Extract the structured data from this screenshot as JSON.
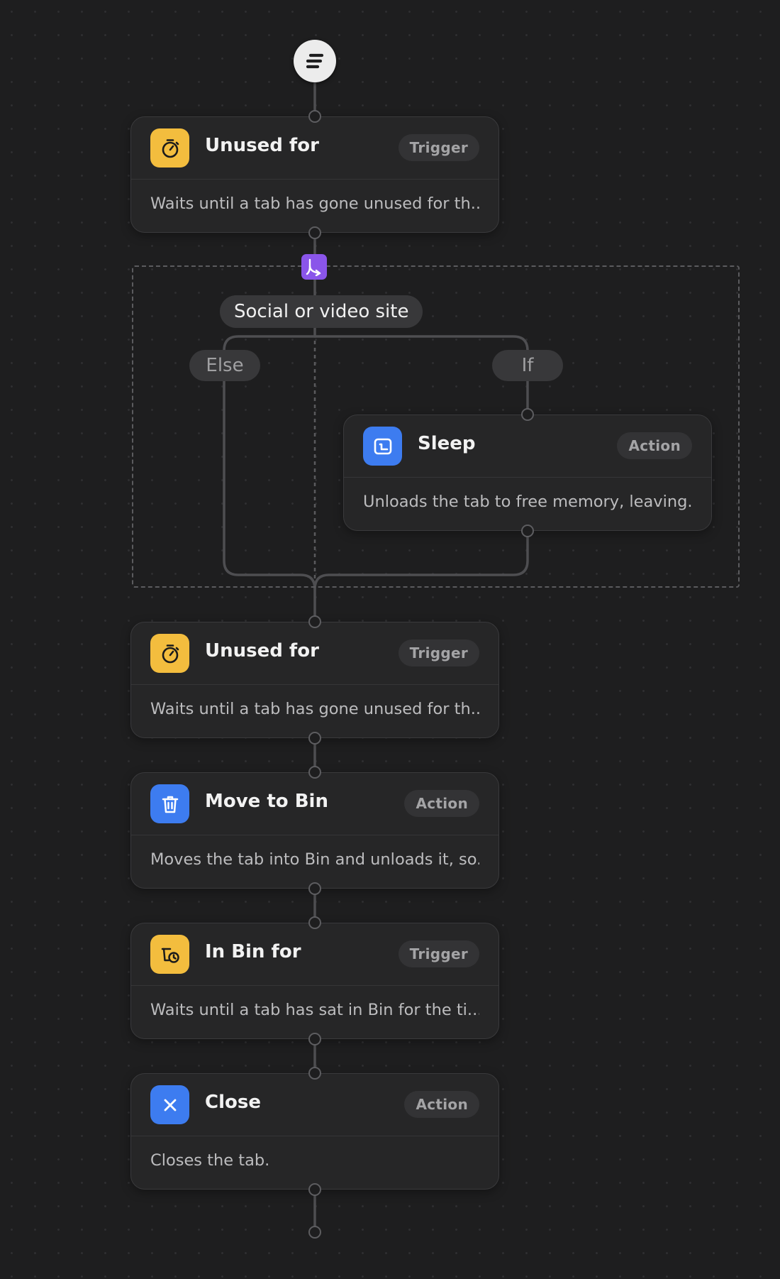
{
  "flow": {
    "condition": "Social or video site",
    "branches": {
      "else": "Else",
      "if": "If"
    },
    "steps": [
      {
        "title": "Unused for",
        "type": "Trigger",
        "description": "Waits until a tab has gone unused for th...",
        "icon": "stopwatch-icon",
        "color": "#f3bd3e"
      },
      {
        "title": "Sleep",
        "type": "Action",
        "description": "Unloads the tab to free memory, leaving...",
        "icon": "sleep-icon",
        "color": "#3d7cf0"
      },
      {
        "title": "Unused for",
        "type": "Trigger",
        "description": "Waits until a tab has gone unused for th...",
        "icon": "stopwatch-icon",
        "color": "#f3bd3e"
      },
      {
        "title": "Move to Bin",
        "type": "Action",
        "description": "Moves the tab into Bin and unloads it, so...",
        "icon": "trash-icon",
        "color": "#3d7cf0"
      },
      {
        "title": "In Bin for",
        "type": "Trigger",
        "description": "Waits until a tab has sat in Bin for the ti...",
        "icon": "bin-clock-icon",
        "color": "#f3bd3e"
      },
      {
        "title": "Close",
        "type": "Action",
        "description": "Closes the tab.",
        "icon": "close-icon",
        "color": "#3d7cf0"
      }
    ]
  },
  "colors": {
    "background": "#1e1e1f",
    "card": "#262627",
    "trigger": "#f3bd3e",
    "action": "#3d7cf0",
    "branch": "#8a55ea"
  }
}
